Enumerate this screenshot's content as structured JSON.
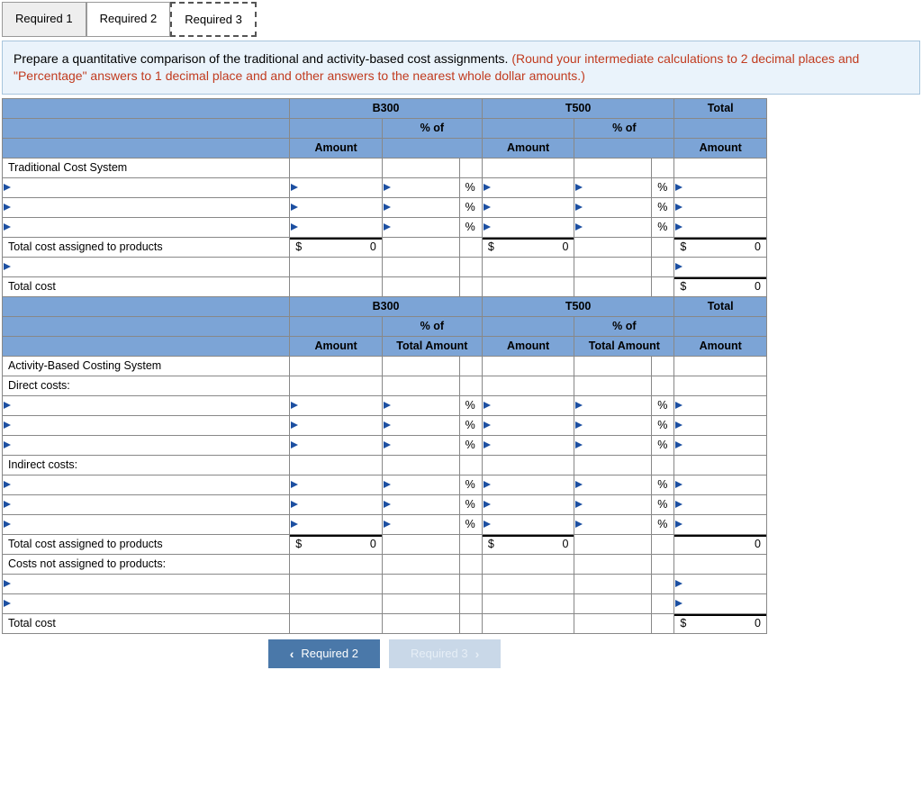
{
  "tabs": {
    "t1": "Required 1",
    "t2": "Required 2",
    "t3": "Required 3"
  },
  "instruction": {
    "black": "Prepare a quantitative comparison of the traditional and activity-based cost assignments. ",
    "red": "(Round your intermediate calculations to 2 decimal places and \"Percentage\" answers to 1 decimal place and and other answers to the nearest whole dollar amounts.)"
  },
  "headers": {
    "b300": "B300",
    "t500": "T500",
    "total": "Total",
    "amount": "Amount",
    "pct_of": "% of",
    "total_amount": "Total Amount"
  },
  "rows": {
    "traditional": "Traditional Cost System",
    "tcap": "Total cost assigned to products",
    "total_cost": "Total cost",
    "abc": "Activity-Based Costing System",
    "direct": "Direct costs:",
    "indirect": "Indirect costs:",
    "not_assigned": "Costs not assigned to products:"
  },
  "unit": {
    "pct": "%"
  },
  "values": {
    "zero": "0"
  },
  "nav": {
    "prev": "Required 2",
    "next": "Required 3"
  },
  "chart_data": {
    "type": "table",
    "sections": [
      {
        "name": "Traditional Cost System",
        "columns": [
          "B300 Amount",
          "B300 % of",
          "T500 Amount",
          "T500 % of",
          "Total Amount"
        ],
        "line_items": 3,
        "totals": {
          "B300 Amount": 0,
          "T500 Amount": 0,
          "Total Amount": 0
        },
        "total_cost": {
          "Total Amount": 0
        }
      },
      {
        "name": "Activity-Based Costing System",
        "columns": [
          "B300 Amount",
          "B300 % of Total Amount",
          "T500 Amount",
          "T500 % of Total Amount",
          "Total Amount"
        ],
        "direct_cost_items": 3,
        "indirect_cost_items": 3,
        "totals": {
          "B300 Amount": 0,
          "T500 Amount": 0,
          "Total Amount": 0
        },
        "costs_not_assigned_items": 2,
        "total_cost": {
          "Total Amount": 0
        }
      }
    ]
  }
}
